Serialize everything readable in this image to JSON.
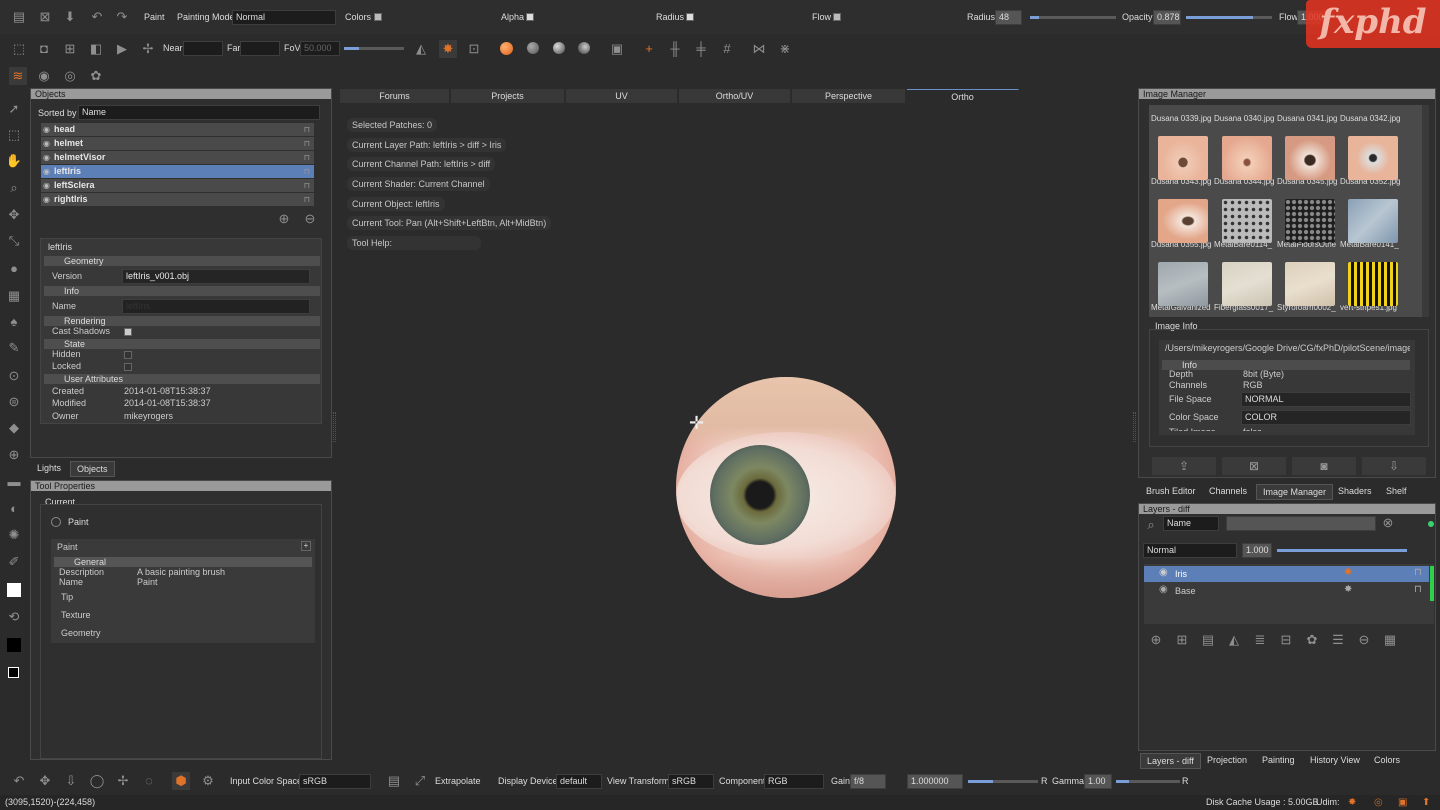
{
  "top": {
    "mode_label": "Paint",
    "painting_mode_label": "Painting Mode",
    "painting_mode_value": "Normal",
    "colors_label": "Colors",
    "alpha_label": "Alpha",
    "radius_chk_label": "Radius",
    "flow_chk_label": "Flow",
    "radius_label": "Radius",
    "radius_value": "48",
    "opacity_label": "Opacity",
    "opacity_value": "0.878",
    "flow_label": "Flow",
    "flow_value": "1.000",
    "watermark": "fxphd"
  },
  "camera": {
    "near_label": "Near",
    "far_label": "Far",
    "fov_label": "FoV",
    "fov_value": "50.000"
  },
  "objects": {
    "title": "Objects",
    "sorted_by_label": "Sorted by",
    "sorted_by_value": "Name",
    "items": [
      {
        "label": "head"
      },
      {
        "label": "helmet"
      },
      {
        "label": "helmetVisor"
      },
      {
        "label": "leftIris",
        "selected": true
      },
      {
        "label": "leftSclera"
      },
      {
        "label": "rightIris"
      }
    ]
  },
  "props": {
    "object_name": "leftIris",
    "geometry_hdr": "Geometry",
    "version_label": "Version",
    "version_value": "leftIris_v001.obj",
    "info_hdr": "Info",
    "name_label": "Name",
    "name_value": "leftIris",
    "rendering_hdr": "Rendering",
    "cast_shadows_label": "Cast Shadows",
    "state_hdr": "State",
    "hidden_label": "Hidden",
    "locked_label": "Locked",
    "user_attr_hdr": "User Attributes",
    "created_label": "Created",
    "created_value": "2014-01-08T15:38:37",
    "modified_label": "Modified",
    "modified_value": "2014-01-08T15:38:37",
    "owner_label": "Owner",
    "owner_value": "mikeyrogers"
  },
  "left_tabs": {
    "lights": "Lights",
    "objects": "Objects"
  },
  "tool_props": {
    "title": "Tool Properties",
    "current_label": "Current",
    "current_tool": "Paint",
    "paint_hdr": "Paint",
    "general_hdr": "General",
    "desc_label": "Description",
    "desc_value": "A basic painting brush",
    "name_label": "Name",
    "name_value": "Paint",
    "tip": "Tip",
    "texture": "Texture",
    "geometry": "Geometry"
  },
  "view_tabs": [
    "Forums",
    "Projects",
    "UV",
    "Ortho/UV",
    "Perspective",
    "Ortho"
  ],
  "viewport_info": [
    "Selected Patches: 0",
    "Current Layer Path: leftIris > diff > Iris",
    "Current Channel Path: leftIris > diff",
    "Current Shader: Current Channel",
    "Current Object: leftIris",
    "Current Tool: Pan (Alt+Shift+LeftBtn, Alt+MidBtn)",
    "Tool Help:"
  ],
  "image_manager": {
    "title": "Image Manager",
    "row0": [
      "Dusana 0339.jpg",
      "Dusana 0340.jpg",
      "Dusana 0341.jpg",
      "Dusana 0342.jpg"
    ],
    "row1": [
      "Dusana 0343.jpg",
      "Dusana 0344.jpg",
      "Dusana 0345.jpg",
      "Dusana 0352.jpg"
    ],
    "row2": [
      "Dusana 0355.jpg",
      "MetalBare0114_",
      "MetalFloorsOthe",
      "MetalBare0141_"
    ],
    "row3": [
      "MetalGalvanized",
      "Fiberglass0017_",
      "Styrofoam0002_",
      "vert-stripes1.jpg"
    ]
  },
  "image_info": {
    "title": "Image Info",
    "path": "/Users/mikeyrogers/Google Drive/CG/fxPhD/pilotScene/images/te",
    "info_hdr": "Info",
    "depth_label": "Depth",
    "depth_value": "8bit  (Byte)",
    "channels_label": "Channels",
    "channels_value": "RGB",
    "filespace_label": "File Space",
    "filespace_value": "NORMAL",
    "colorspace_label": "Color Space",
    "colorspace_value": "COLOR",
    "tiled_label": "Tiled Image",
    "tiled_value": "false"
  },
  "right_tabs": [
    "Brush Editor",
    "Channels",
    "Image Manager",
    "Shaders",
    "Shelf"
  ],
  "layers": {
    "title": "Layers - diff",
    "filter_value": "Name",
    "blend_value": "Normal",
    "opacity_value": "1.000",
    "items": [
      {
        "label": "Iris",
        "selected": true
      },
      {
        "label": "Base"
      }
    ]
  },
  "right_bottom_tabs": [
    "Layers - diff",
    "Projection",
    "Painting",
    "History View",
    "Colors"
  ],
  "bottom": {
    "input_cs_label": "Input Color Space",
    "input_cs_value": "sRGB",
    "extrapolate_label": "Extrapolate",
    "display_device_label": "Display Device",
    "display_device_value": "default",
    "view_transform_label": "View Transform",
    "view_transform_value": "sRGB",
    "component_label": "Component",
    "component_value": "RGB",
    "gain_label": "Gain",
    "gain_value": "f/8",
    "gain_num": "1.000000",
    "gain_r": "R",
    "gamma_label": "Gamma",
    "gamma_value": "1.00",
    "gamma_r": "R"
  },
  "status": {
    "coords": "(3095,1520)-(224,458)",
    "disk_cache": "Disk Cache Usage : 5.00GB",
    "udim": "Udim:"
  },
  "colors": {
    "accent": "#5c7fb8",
    "brush_orange": "#e0732a",
    "watermark": "#e8321e"
  }
}
